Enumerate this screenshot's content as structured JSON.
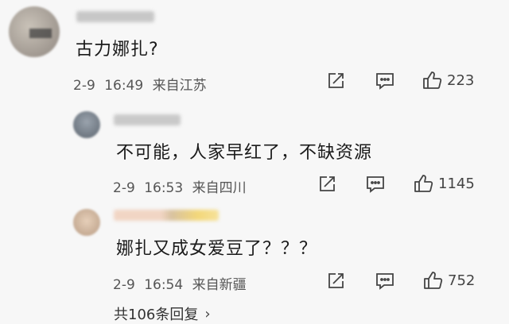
{
  "comments": [
    {
      "text": "古力娜扎?",
      "date": "2-9",
      "time": "16:49",
      "location": "来自江苏",
      "likes": "223"
    },
    {
      "text": "不可能，人家早红了，不缺资源",
      "date": "2-9",
      "time": "16:53",
      "location": "来自四川",
      "likes": "1145"
    },
    {
      "text": "娜扎又成女爱豆了？？？",
      "date": "2-9",
      "time": "16:54",
      "location": "来自新疆",
      "likes": "752"
    }
  ],
  "footer": {
    "more_replies": "共106条回复"
  },
  "colors": {
    "background": "#f7f7f7",
    "icon": "#444444"
  }
}
